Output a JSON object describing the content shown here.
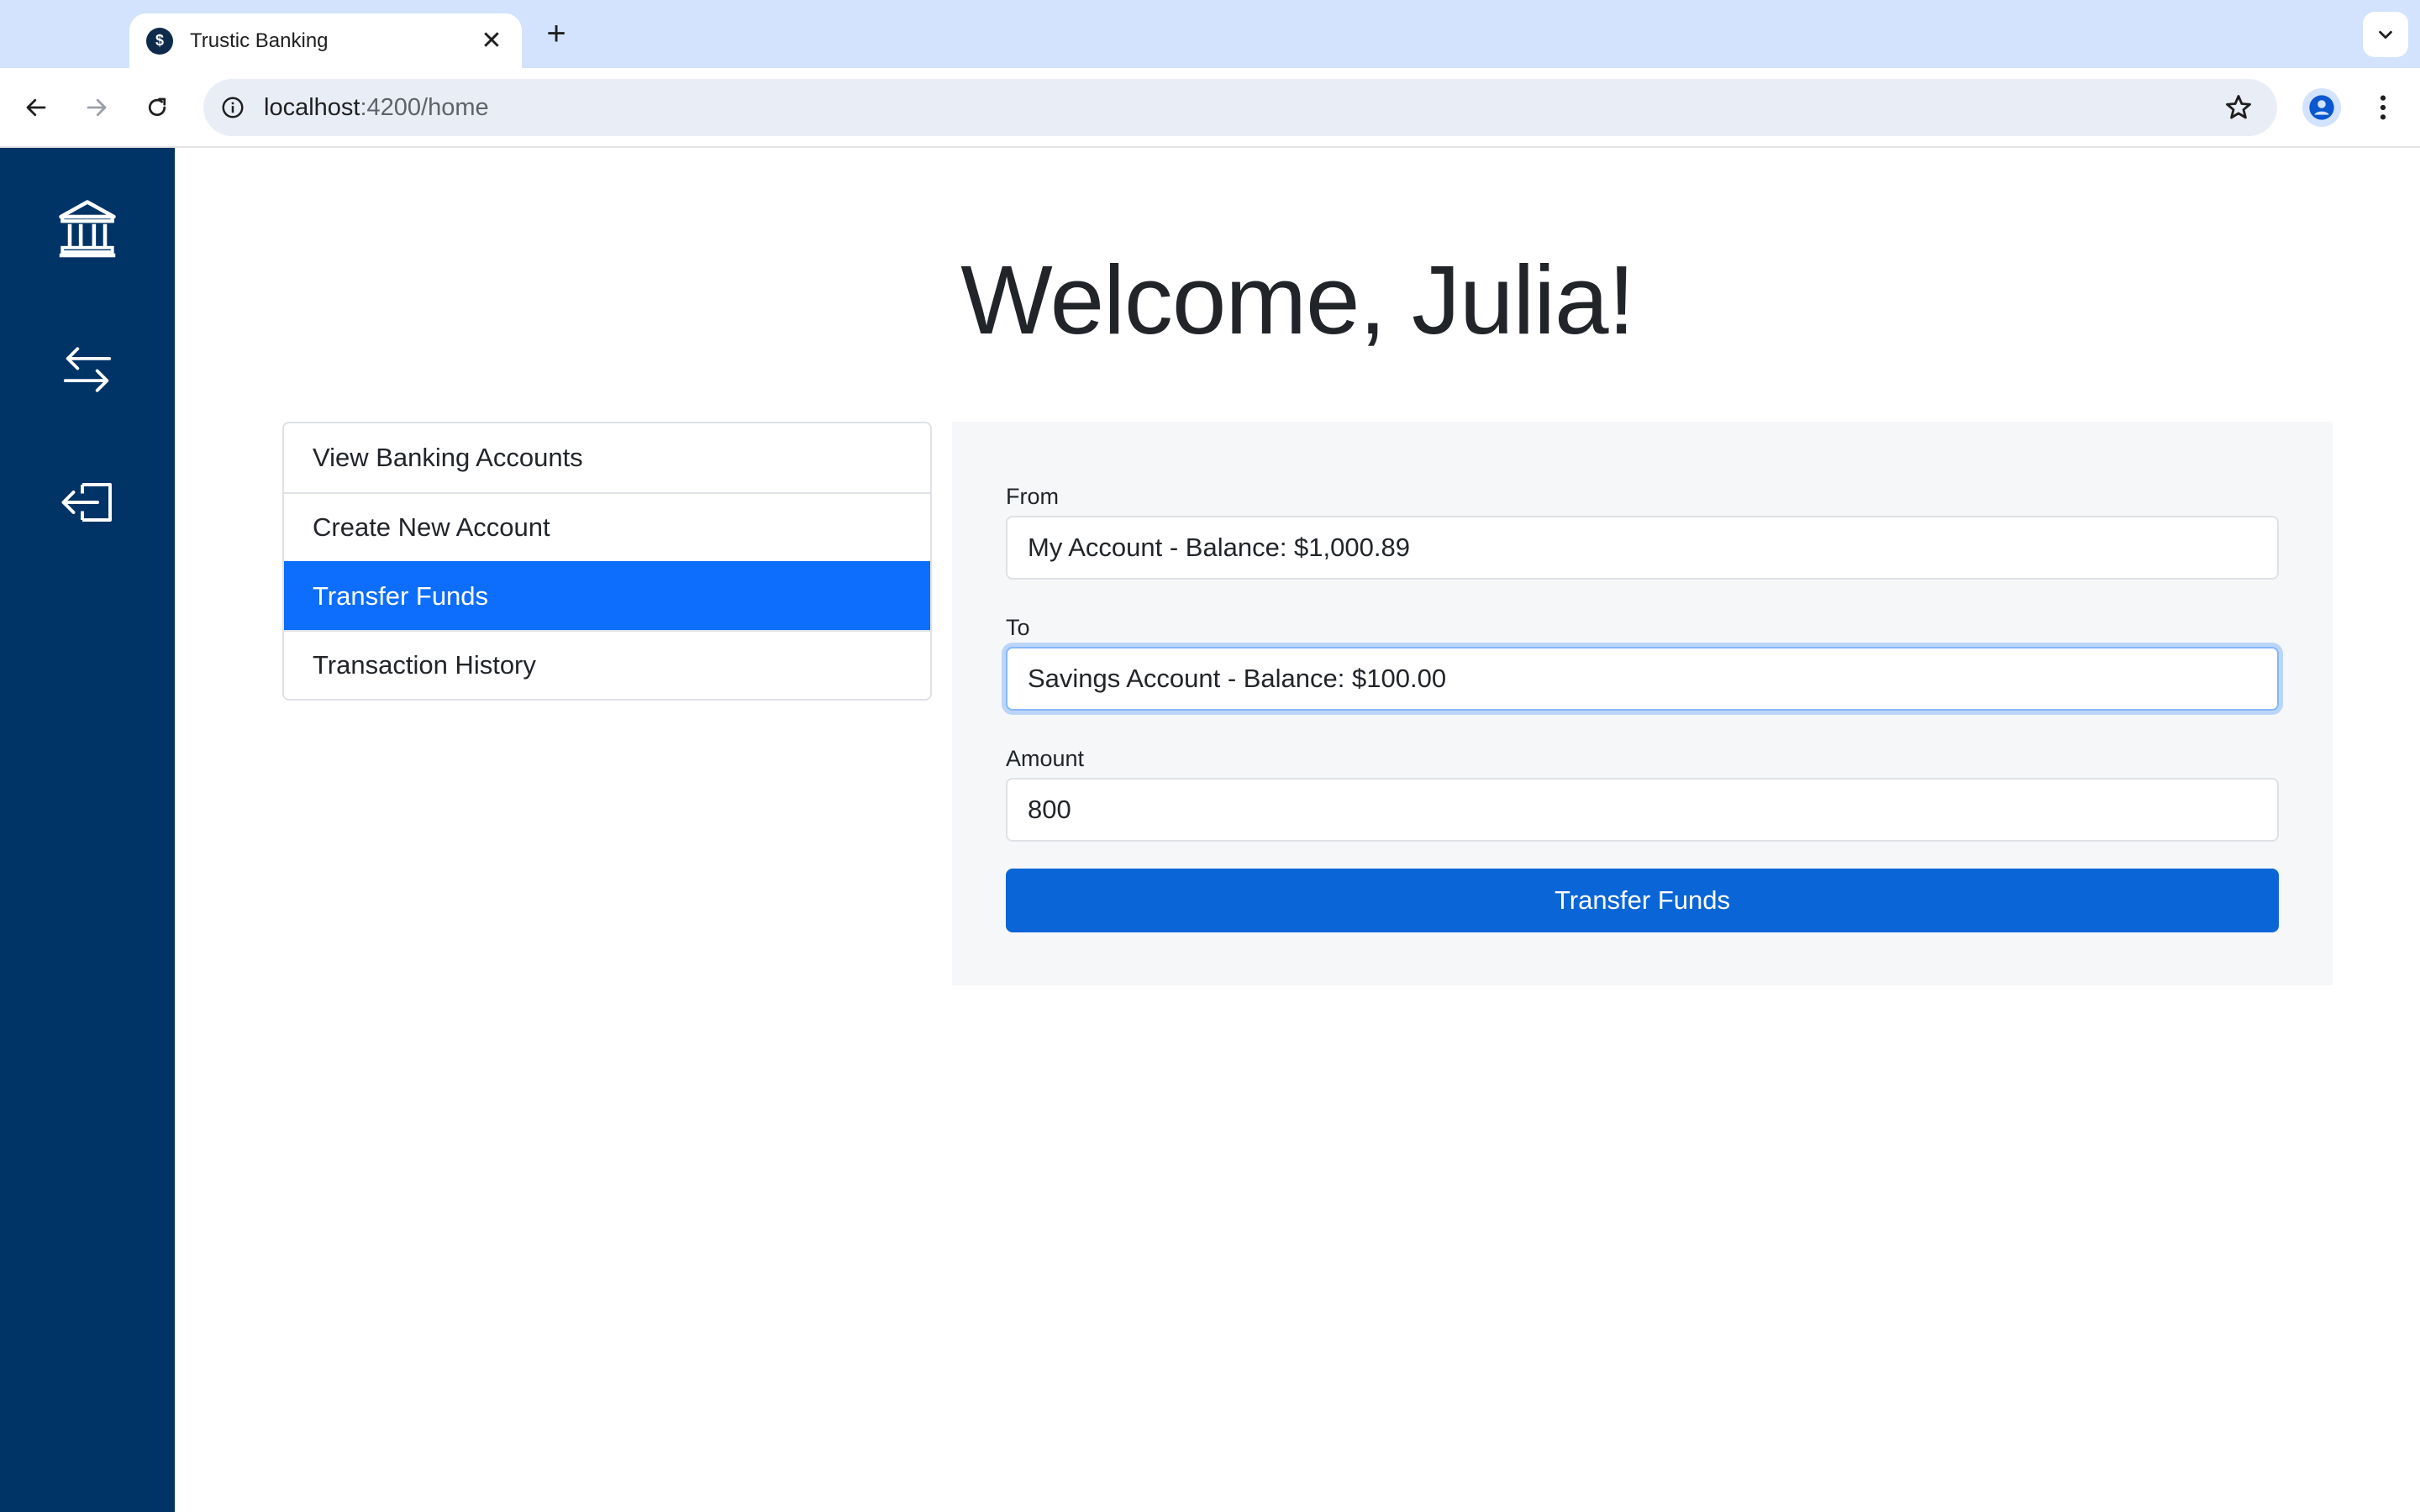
{
  "browser": {
    "tab_title": "Trustic Banking",
    "tab_favicon_glyph": "$",
    "tab_close_glyph": "✕",
    "new_tab_glyph": "+",
    "url_host": "localhost",
    "url_rest": ":4200/home"
  },
  "sidebar": {
    "icons": [
      "bank-icon",
      "transfer-arrows-icon",
      "logout-icon"
    ]
  },
  "main": {
    "welcome": "Welcome, Julia!",
    "menu": [
      {
        "label": "View Banking Accounts",
        "active": false
      },
      {
        "label": "Create New Account",
        "active": false
      },
      {
        "label": "Transfer Funds",
        "active": true
      },
      {
        "label": "Transaction History",
        "active": false
      }
    ],
    "form": {
      "from_label": "From",
      "from_value": "My Account - Balance: $1,000.89",
      "to_label": "To",
      "to_value": "Savings Account - Balance: $100.00",
      "amount_label": "Amount",
      "amount_value": "800",
      "submit_label": "Transfer Funds"
    }
  },
  "colors": {
    "sidebar_bg": "#003366",
    "active_item": "#0d6efd",
    "submit_button": "#0a66d6"
  }
}
